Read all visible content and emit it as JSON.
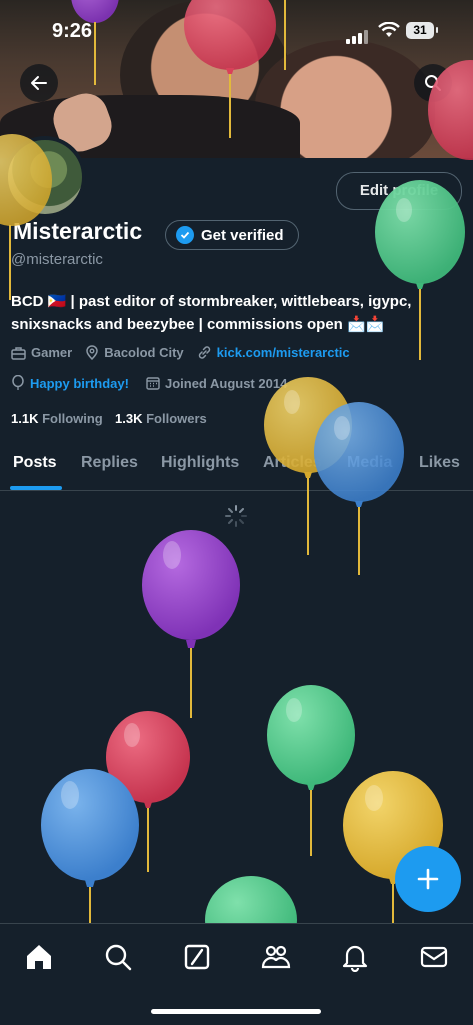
{
  "status_bar": {
    "time": "9:26",
    "battery": "31"
  },
  "profile": {
    "display_name": "Misterarctic",
    "get_verified_label": "Get verified",
    "handle": "@misterarctic",
    "edit_profile_label": "Edit profile",
    "bio_line1": "BCD 🇵🇭 | past editor of stormbreaker, wittlebears, igypc,",
    "bio_line2": "snixsnacks and beezybee | commissions open 📩📩",
    "category": "Gamer",
    "location": "Bacolod City",
    "link": "kick.com/misterarctic",
    "birthday": "Happy birthday!",
    "joined": "Joined August 2014",
    "following_count": "1.1K",
    "following_label": "Following",
    "followers_count": "1.3K",
    "followers_label": "Followers"
  },
  "tabs": [
    {
      "label": "Posts",
      "active": true
    },
    {
      "label": "Replies"
    },
    {
      "label": "Highlights"
    },
    {
      "label": "Articles"
    },
    {
      "label": "Media"
    },
    {
      "label": "Likes"
    }
  ],
  "bottom_nav": [
    "home-icon",
    "search-icon",
    "grok-icon",
    "communities-icon",
    "notifications-icon",
    "messages-icon"
  ],
  "colors": {
    "accent": "#1d9bf0",
    "background": "#15202b",
    "balloon_green": "#4fc98a",
    "balloon_yellow": "#e2b93b",
    "balloon_blue": "#4a90d9",
    "balloon_purple": "#8e3fc4",
    "balloon_red": "#d9415a"
  }
}
